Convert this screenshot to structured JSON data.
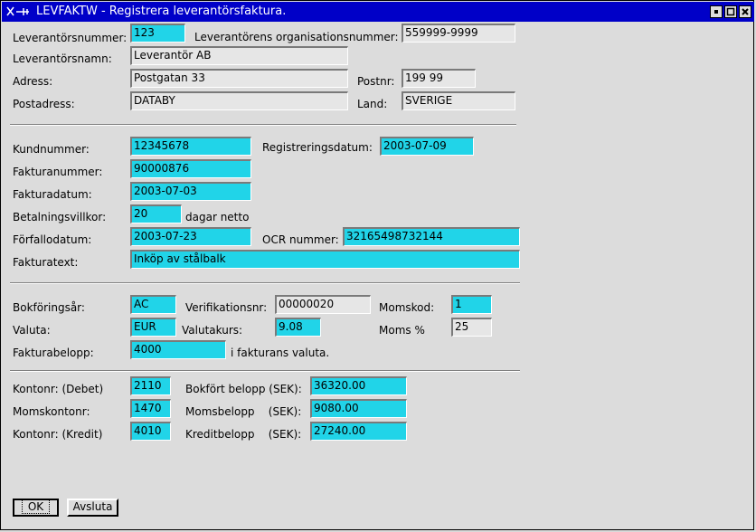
{
  "window": {
    "title": "LEVFAKTW - Registrera leverantörsfaktura."
  },
  "supplier": {
    "number_label": "Leverantörsnummer:",
    "number": "123",
    "org_label": "Leverantörens organisationsnummer:",
    "org": "559999-9999",
    "name_label": "Leverantörsnamn:",
    "name": "Leverantör AB",
    "address_label": "Adress:",
    "address": "Postgatan 33",
    "postnr_label": "Postnr:",
    "postnr": "199 99",
    "postadress_label": "Postadress:",
    "postadress": "DATABY",
    "country_label": "Land:",
    "country": "SVERIGE"
  },
  "invoice": {
    "customer_label": "Kundnummer:",
    "customer": "12345678",
    "regdate_label": "Registreringsdatum:",
    "regdate": "2003-07-09",
    "number_label": "Fakturanummer:",
    "number": "90000876",
    "date_label": "Fakturadatum:",
    "date": "2003-07-03",
    "terms_label": "Betalningsvillkor:",
    "terms": "20",
    "terms_suffix": "dagar netto",
    "due_label": "Förfallodatum:",
    "due": "2003-07-23",
    "ocr_label": "OCR nummer:",
    "ocr": "32165498732144",
    "text_label": "Fakturatext:",
    "text": "Inköp av stålbalk"
  },
  "accounting": {
    "year_label": "Bokföringsår:",
    "year": "AC",
    "verif_label": "Verifikationsnr:",
    "verif": "00000020",
    "vatcode_label": "Momskod:",
    "vatcode": "1",
    "currency_label": "Valuta:",
    "currency": "EUR",
    "rate_label": "Valutakurs:",
    "rate": "9.08",
    "vatpct_label": "Moms %",
    "vatpct": "25",
    "amount_label": "Fakturabelopp:",
    "amount": "4000",
    "amount_suffix": "i fakturans valuta."
  },
  "accounts": {
    "debit_label": "Kontonr: (Debet)",
    "debit": "2110",
    "booked_label": "Bokfört belopp (SEK):",
    "booked": "36320.00",
    "vatacct_label": "Momskontonr:",
    "vatacct": "1470",
    "vatamount_label": "Momsbelopp    (SEK):",
    "vatamount": "9080.00",
    "credit_label": "Kontonr: (Kredit)",
    "credit": "4010",
    "creditamount_label": "Kreditbelopp    (SEK):",
    "creditamount": "27240.00"
  },
  "buttons": {
    "ok": "OK",
    "quit": "Avsluta"
  },
  "colors": {
    "titlebar": "#0000c8",
    "editable_field": "#21d4e8",
    "readonly_field": "#e6e6e6"
  }
}
